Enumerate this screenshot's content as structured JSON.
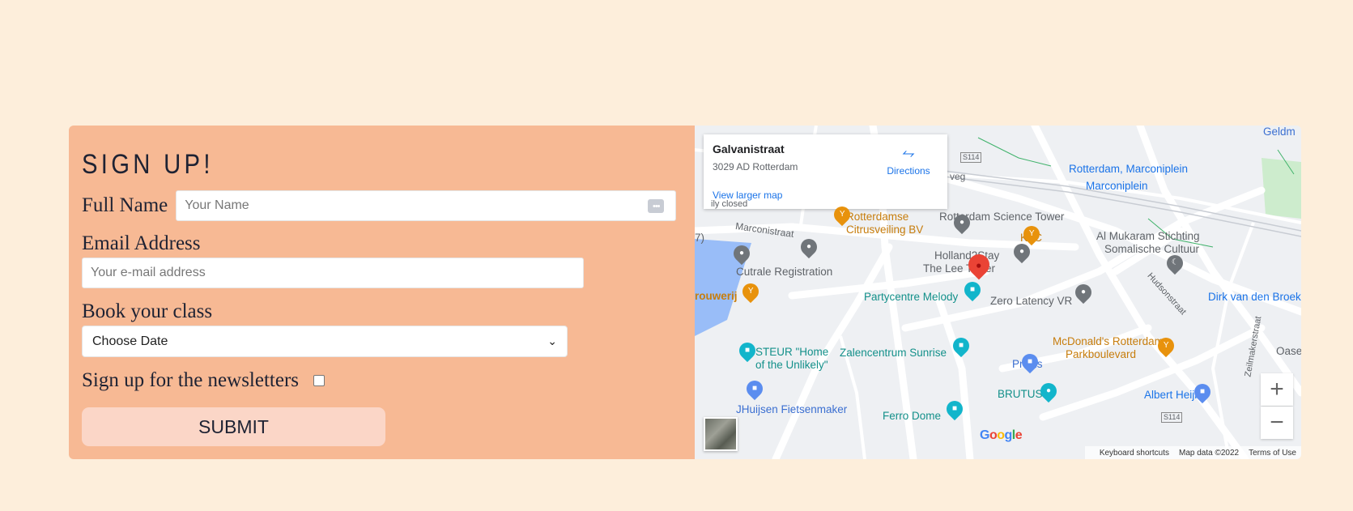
{
  "form": {
    "title": "SIGN UP!",
    "name_label": "Full Name",
    "name_placeholder": "Your Name",
    "email_label": "Email Address",
    "email_placeholder": "Your e-mail address",
    "class_label": "Book your class",
    "class_select_value": "Choose Date",
    "newsletter_label": "Sign up for the newsletters",
    "newsletter_checked": false,
    "submit_label": "SUBMIT"
  },
  "map": {
    "info": {
      "place": "Galvanistraat",
      "address": "3029 AD Rotterdam",
      "directions": "Directions",
      "larger_map": "View larger map"
    },
    "labels": {
      "rotterdamse": "Rotterdamse",
      "citrusveiling": "Citrusveiling BV",
      "science_tower": "Rotterdam Science Tower",
      "marconistraat": "Marconistraat",
      "kfc": "KFC",
      "holland2stay": "Holland2Stay",
      "lee_tower": "The Lee Tower",
      "cutrale": "Cutrale Registration",
      "partycentre": "Partycentre Melody",
      "zero_latency": "Zero Latency VR",
      "brouwerij": "rouwerij",
      "steur1": "STEUR \"Home",
      "steur2": "of the Unlikely\"",
      "zalencentrum": "Zalencentrum Sunrise",
      "praxis": "Praxis",
      "brutus": "BRUTUS",
      "fietsenmaker": "JHuijsen Fietsenmaker",
      "ferro": "Ferro Dome",
      "marconiplein1": "Rotterdam, Marconiplein",
      "marconiplein2": "Marconiplein",
      "mukaram1": "Al Mukaram Stichting",
      "mukaram2": "Somalische Cultuur",
      "hudsonstraat": "Hudsonstraat",
      "dirk": "Dirk van den Broek",
      "mcdonalds1": "McDonald's Rotterdam",
      "mcdonalds2": "Parkboulevard",
      "albert": "Albert Heijn",
      "zeilmakerstraat": "Zeilmakerstraat",
      "oase": "Oase",
      "s114a": "S114",
      "s114b": "S114",
      "closed": "ily closed",
      "weg": "veg",
      "geldm": "Geldm",
      "seven": "7)"
    },
    "google": "Google",
    "footer": {
      "shortcuts": "Keyboard shortcuts",
      "mapdata": "Map data ©2022",
      "terms": "Terms of Use"
    },
    "zoom_in": "+",
    "zoom_out": "−"
  }
}
